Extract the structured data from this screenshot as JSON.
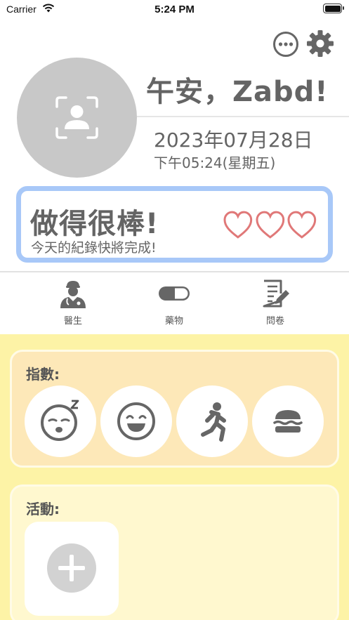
{
  "status_bar": {
    "carrier": "Carrier",
    "time": "5:24 PM",
    "battery_level": 1.0
  },
  "header": {
    "greeting": "午安，Zabd!",
    "date": "2023年07月28日",
    "time_day": "下午05:24(星期五)"
  },
  "banner": {
    "title": "做得很棒!",
    "subtitle": "今天的紀錄快將完成!",
    "hearts_count": 3
  },
  "nav": [
    {
      "label": "醫生",
      "icon": "doctor-icon"
    },
    {
      "label": "藥物",
      "icon": "pill-icon"
    },
    {
      "label": "問卷",
      "icon": "questionnaire-icon"
    }
  ],
  "index_section": {
    "title": "指數:",
    "items": [
      {
        "icon": "sleep-face-icon"
      },
      {
        "icon": "happy-face-icon"
      },
      {
        "icon": "running-icon"
      },
      {
        "icon": "burger-icon"
      }
    ]
  },
  "activity_section": {
    "title": "活動:",
    "add_icon": "plus-icon"
  },
  "colors": {
    "banner_border": "#a8c8f8",
    "heart": "#e07878",
    "yellow_bg": "#fdf3a6",
    "index_card": "#fde8b8",
    "activity_card": "#fff8cf",
    "icon_gray": "#666666"
  }
}
